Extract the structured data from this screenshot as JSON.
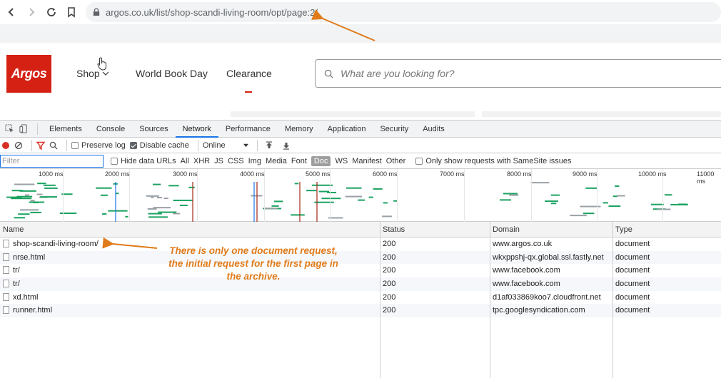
{
  "browser": {
    "url": "argos.co.uk/list/shop-scandi-living-room/opt/page:2/"
  },
  "site": {
    "logo_text": "Argos",
    "nav": {
      "shop": "Shop",
      "world_book_day": "World Book Day",
      "clearance": "Clearance"
    },
    "search_placeholder": "What are you looking for?"
  },
  "devtools": {
    "tabs": [
      "Elements",
      "Console",
      "Sources",
      "Network",
      "Performance",
      "Memory",
      "Application",
      "Security",
      "Audits"
    ],
    "active_tab": "Network",
    "toolbar": {
      "preserve_log": "Preserve log",
      "disable_cache": "Disable cache",
      "throttle": "Online"
    },
    "filter": {
      "placeholder": "Filter",
      "hide_data_urls": "Hide data URLs",
      "types": [
        "All",
        "XHR",
        "JS",
        "CSS",
        "Img",
        "Media",
        "Font",
        "Doc",
        "WS",
        "Manifest",
        "Other"
      ],
      "active_type": "Doc",
      "samesite": "Only show requests with SameSite issues"
    },
    "timeline_ticks": [
      "1000 ms",
      "2000 ms",
      "3000 ms",
      "4000 ms",
      "5000 ms",
      "6000 ms",
      "7000 ms",
      "8000 ms",
      "9000 ms",
      "10000 ms",
      "11000 ms"
    ],
    "columns": {
      "name": "Name",
      "status": "Status",
      "domain": "Domain",
      "type": "Type"
    },
    "rows": [
      {
        "name": "shop-scandi-living-room/",
        "status": "200",
        "domain": "www.argos.co.uk",
        "type": "document"
      },
      {
        "name": "nrse.html",
        "status": "200",
        "domain": "wkxppshj-qx.global.ssl.fastly.net",
        "type": "document"
      },
      {
        "name": "tr/",
        "status": "200",
        "domain": "www.facebook.com",
        "type": "document"
      },
      {
        "name": "tr/",
        "status": "200",
        "domain": "www.facebook.com",
        "type": "document"
      },
      {
        "name": "xd.html",
        "status": "200",
        "domain": "d1af033869koo7.cloudfront.net",
        "type": "document"
      },
      {
        "name": "runner.html",
        "status": "200",
        "domain": "tpc.googlesyndication.com",
        "type": "document"
      }
    ]
  },
  "annotation": {
    "line1": "There is only one document request,",
    "line2": "the initial request for the first page in",
    "line3": "the archive."
  },
  "colors": {
    "argos_red": "#d42114",
    "annotation_orange": "#e07b1a",
    "devtools_blue": "#1a73e8"
  }
}
